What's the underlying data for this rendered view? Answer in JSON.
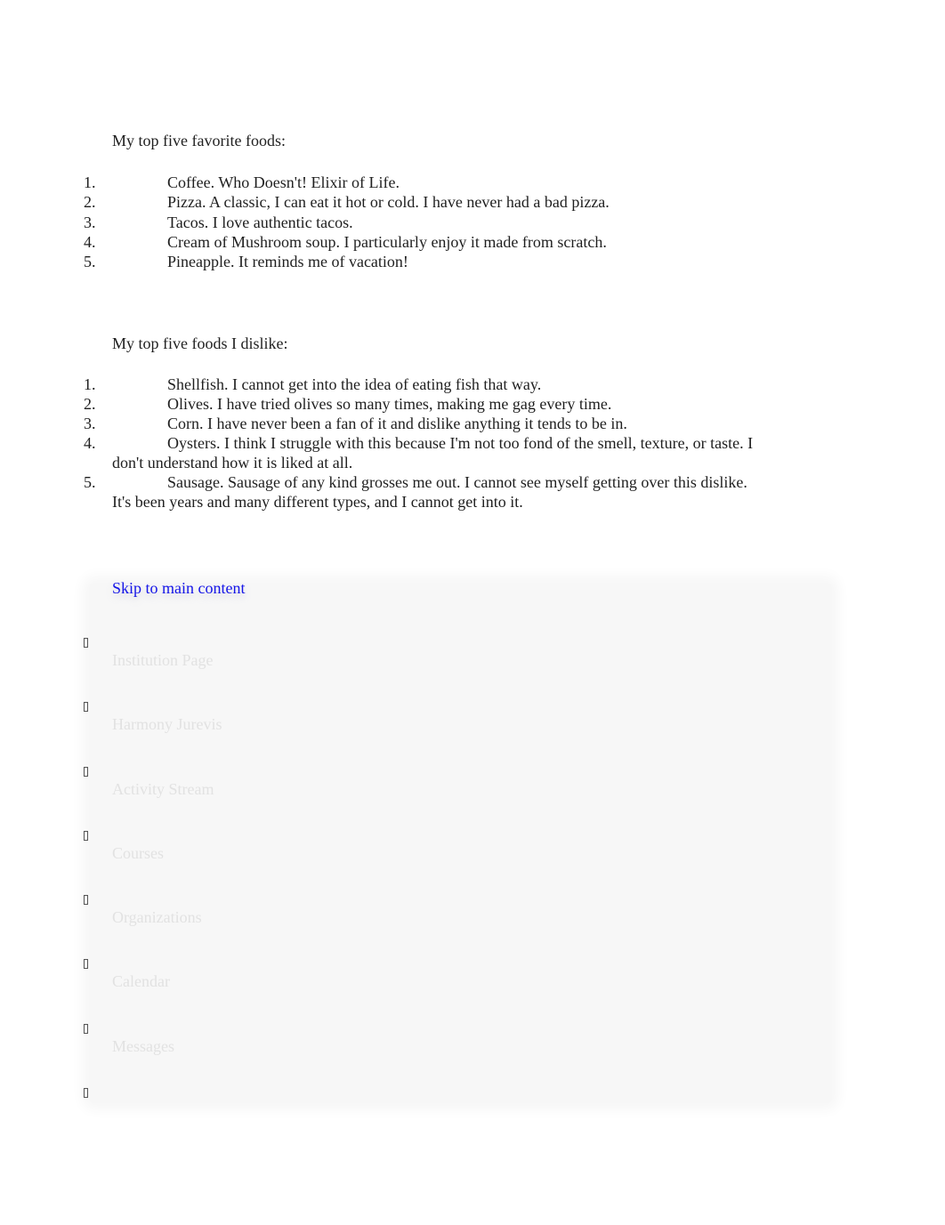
{
  "favorites": {
    "heading": "My top five favorite foods:",
    "items": [
      {
        "num": "1.",
        "text": "Coffee. Who Doesn't! Elixir of Life."
      },
      {
        "num": "2.",
        "text": "Pizza. A classic, I can eat it hot or cold. I have never had a bad pizza."
      },
      {
        "num": "3.",
        "text": "Tacos. I love authentic tacos."
      },
      {
        "num": "4.",
        "text": "Cream of Mushroom soup. I particularly enjoy it made from scratch."
      },
      {
        "num": "5.",
        "text": "Pineapple. It reminds me of vacation!"
      }
    ]
  },
  "dislikes": {
    "heading": "My top five foods I dislike:",
    "items": [
      {
        "num": "1.",
        "text": "Shellfish. I cannot get into the idea of eating fish that way."
      },
      {
        "num": "2.",
        "text": "Olives. I have tried olives so many times, making me gag every time."
      },
      {
        "num": "3.",
        "text": "Corn. I have never been a fan of it and dislike anything it tends to be in."
      },
      {
        "num": "4.",
        "text": "Oysters. I think I struggle with this because I'm not too fond of the smell, texture, or taste. I don't understand how it is liked at all."
      },
      {
        "num": "5.",
        "text": "Sausage. Sausage of any kind grosses me out. I cannot see myself getting over this dislike. It's been years and many different types, and I cannot get into it."
      }
    ]
  },
  "nav": {
    "skip_link": "Skip to main content",
    "items": [
      {
        "label": "Institution Page",
        "icon": "missing-glyph-icon"
      },
      {
        "label": "Harmony Jurevis",
        "icon": "missing-glyph-icon"
      },
      {
        "label": "Activity Stream",
        "icon": "missing-glyph-icon"
      },
      {
        "label": "Courses",
        "icon": "missing-glyph-icon"
      },
      {
        "label": "Organizations",
        "icon": "missing-glyph-icon"
      },
      {
        "label": "Calendar",
        "icon": "missing-glyph-icon"
      },
      {
        "label": "Messages",
        "icon": "missing-glyph-icon"
      },
      {
        "label": "",
        "icon": "missing-glyph-icon"
      }
    ]
  },
  "colors": {
    "link": "#1515e8",
    "text": "#1f1f1f",
    "faded_text": "#e2e2e2",
    "panel": "#f7f7f7"
  }
}
